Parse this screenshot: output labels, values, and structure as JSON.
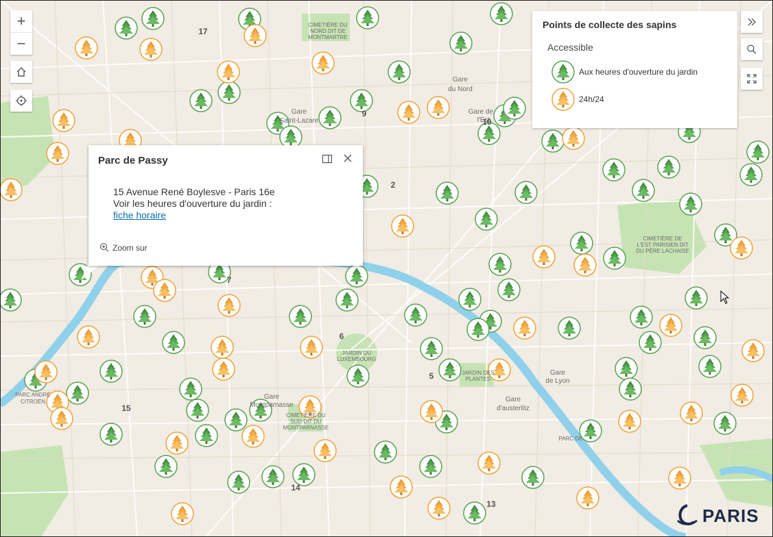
{
  "legend": {
    "title": "Points de collecte des sapins",
    "subtitle": "Accessible",
    "items": [
      {
        "label": "Aux heures d'ouverture du jardin",
        "icon": "green-tree-icon"
      },
      {
        "label": "24h/24",
        "icon": "orange-tree-icon"
      }
    ]
  },
  "popup": {
    "title": "Parc de Passy",
    "address": "15 Avenue René Boylesve - Paris 16e",
    "hours_text": "Voir les heures d'ouverture du jardin :",
    "link_text": "fiche horaire",
    "zoom_label": "Zoom sur"
  },
  "map_labels": {
    "stations": [
      {
        "name": "Gare Saint-Lazare",
        "lines": [
          "Gare",
          "Saint-Lazare"
        ]
      },
      {
        "name": "Gare du Nord",
        "lines": [
          "Gare",
          "du Nord"
        ]
      },
      {
        "name": "Gare de l'Est",
        "lines": [
          "Gare de",
          "l'Est"
        ]
      },
      {
        "name": "Gare de Lyon",
        "lines": [
          "Gare",
          "de Lyon"
        ]
      },
      {
        "name": "Gare d'austerlitz",
        "lines": [
          "Gare",
          "d'austerlitz"
        ]
      },
      {
        "name": "Gare Montparnasse",
        "lines": [
          "Gare",
          "Montparnasse"
        ]
      }
    ],
    "places": [
      {
        "name": "Cimetière de Montmartre",
        "lines": [
          "CIMETIÈRE DU",
          "NORD DIT DE",
          "MONTMARTRE"
        ]
      },
      {
        "name": "Cimetière du Père Lachaise",
        "lines": [
          "CIMETIÈRE DE",
          "L'EST PARISIEN DIT",
          "DU PÈRE LACHAISE"
        ]
      },
      {
        "name": "Jardin du Luxembourg",
        "lines": [
          "JARDIN DU",
          "LUXEMBOURG"
        ]
      },
      {
        "name": "Jardin des Plantes",
        "lines": [
          "JARDIN DES",
          "PLANTES"
        ]
      },
      {
        "name": "Cimetière du Montparnasse",
        "lines": [
          "CIMETIÈRE DU",
          "SUD DIT DU",
          "MONTPARNASSE"
        ]
      },
      {
        "name": "Parc André Citroën",
        "lines": [
          "PARC ANDRÉ",
          "CITROËN"
        ]
      },
      {
        "name": "Parc de Bercy",
        "lines": [
          "PARC DE"
        ]
      }
    ],
    "arrondissements": [
      "17",
      "9",
      "2",
      "10",
      "7",
      "6",
      "5",
      "15",
      "14",
      "13"
    ]
  },
  "colors": {
    "accent_green": "#5fa85a",
    "accent_orange": "#f0a23a",
    "river": "#8fd0ea",
    "park": "#c6e3b4",
    "land": "#f1ece4",
    "logo": "#1d2c4a"
  },
  "controls": {
    "zoom_in": "+",
    "zoom_out": "−"
  },
  "logo_text": "PARIS"
}
